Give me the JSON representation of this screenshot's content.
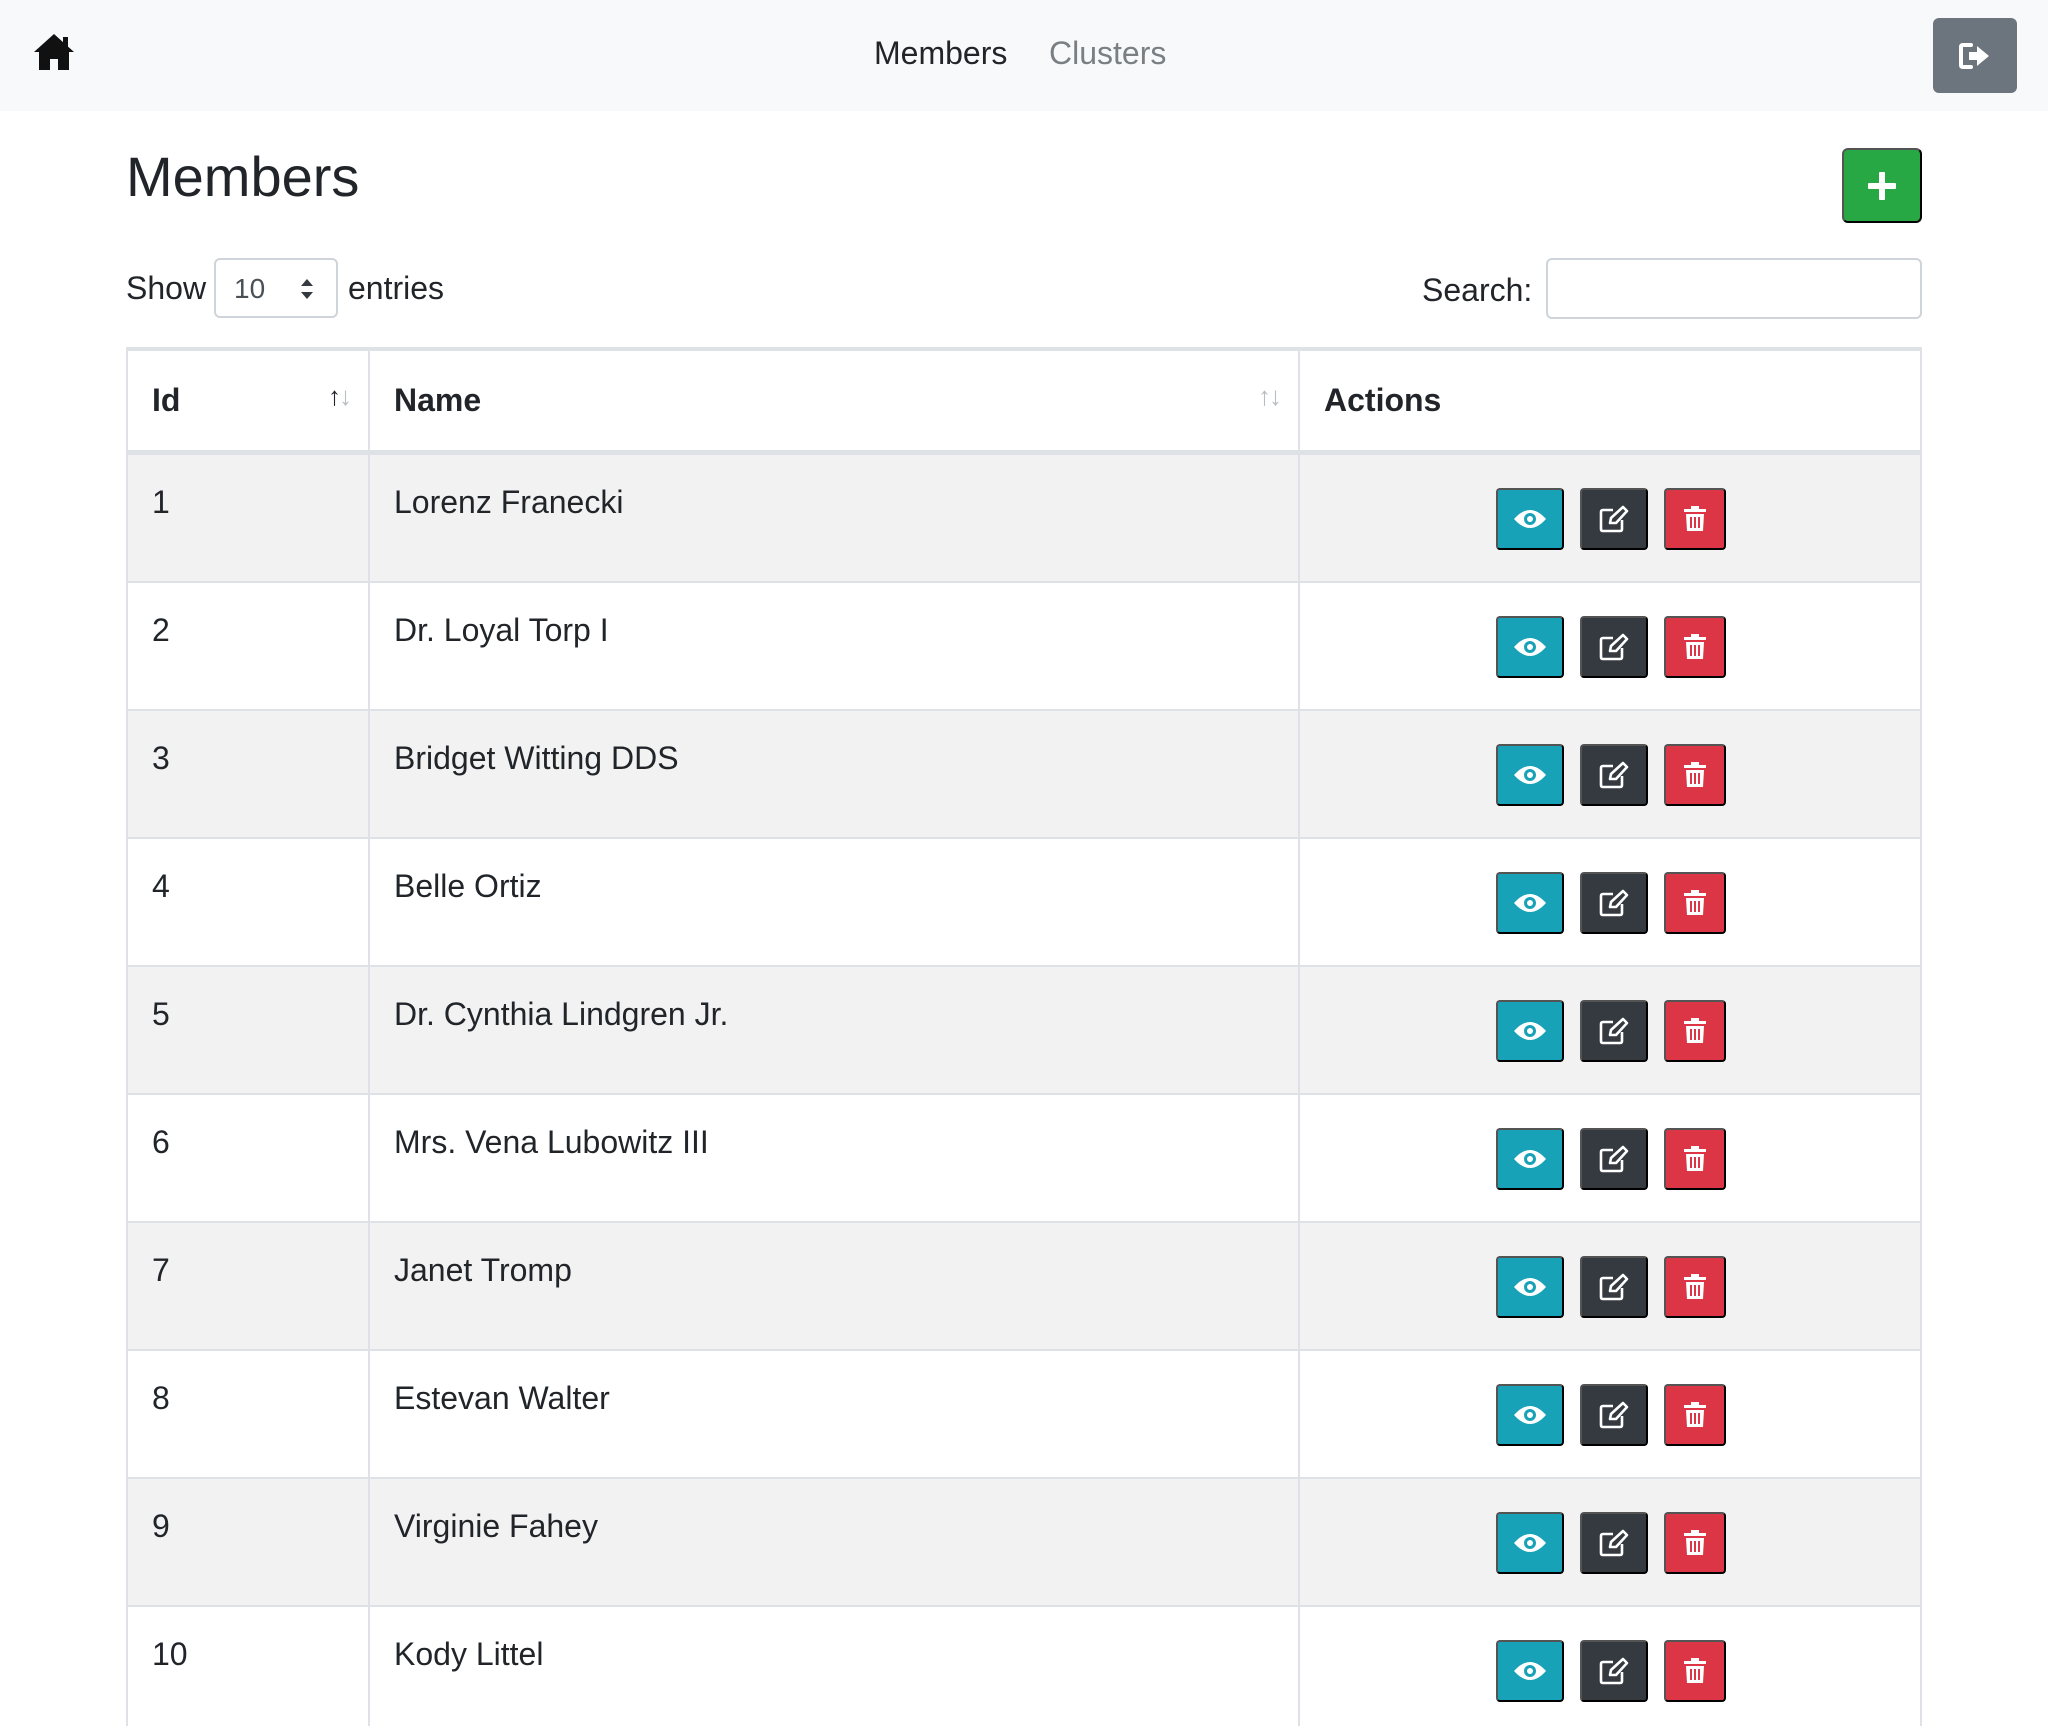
{
  "nav": {
    "home_icon": "home-icon",
    "links": [
      {
        "label": "Members",
        "active": true
      },
      {
        "label": "Clusters",
        "active": false
      }
    ],
    "logout_icon": "sign-out-icon"
  },
  "page": {
    "title": "Members",
    "add_icon": "plus-icon"
  },
  "controls": {
    "show_label": "Show",
    "entries_value": "10",
    "entries_label": "entries",
    "search_label": "Search:",
    "search_value": ""
  },
  "table": {
    "columns": [
      "Id",
      "Name",
      "Actions"
    ],
    "rows": [
      {
        "id": "1",
        "name": "Lorenz Franecki"
      },
      {
        "id": "2",
        "name": "Dr. Loyal Torp I"
      },
      {
        "id": "3",
        "name": "Bridget Witting DDS"
      },
      {
        "id": "4",
        "name": "Belle Ortiz"
      },
      {
        "id": "5",
        "name": "Dr. Cynthia Lindgren Jr."
      },
      {
        "id": "6",
        "name": "Mrs. Vena Lubowitz III"
      },
      {
        "id": "7",
        "name": "Janet Tromp"
      },
      {
        "id": "8",
        "name": "Estevan Walter"
      },
      {
        "id": "9",
        "name": "Virginie Fahey"
      },
      {
        "id": "10",
        "name": "Kody Littel"
      }
    ],
    "action_icons": [
      "eye-icon",
      "edit-icon",
      "trash-icon"
    ]
  },
  "colors": {
    "view": "#17a2b8",
    "edit": "#343a40",
    "delete": "#dc3545",
    "add": "#28a745",
    "logout": "#6c757d"
  }
}
